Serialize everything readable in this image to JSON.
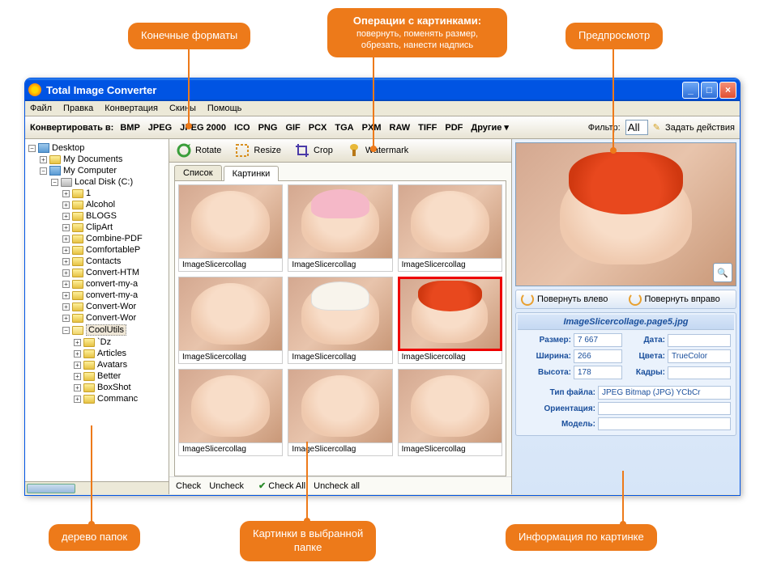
{
  "callouts": {
    "formats": "Конечные форматы",
    "ops": {
      "title": "Операции с картинками:",
      "sub": "повернуть, поменять размер, обрезать, нанести надпись"
    },
    "preview": "Предпросмотр",
    "tree": "дерево папок",
    "thumbs": {
      "l1": "Картинки в выбранной",
      "l2": "папке"
    },
    "info": "Информация по картинке"
  },
  "titlebar": {
    "title": "Total Image Converter"
  },
  "menu": {
    "file": "Файл",
    "edit": "Правка",
    "convert": "Конвертация",
    "skins": "Скины",
    "help": "Помощь"
  },
  "toolbar": {
    "label": "Конвертировать в:",
    "formats": [
      "BMP",
      "JPEG",
      "JPEG 2000",
      "ICO",
      "PNG",
      "GIF",
      "PCX",
      "TGA",
      "PXM",
      "RAW",
      "TIFF",
      "PDF"
    ],
    "more": "Другие",
    "filter": "Фильтр:",
    "filter_val": "All",
    "actions": "Задать действия"
  },
  "ops": {
    "rotate": "Rotate",
    "resize": "Resize",
    "crop": "Crop",
    "watermark": "Watermark"
  },
  "tabs": {
    "list": "Список",
    "pics": "Картинки"
  },
  "tree": {
    "desktop": "Desktop",
    "docs": "My Documents",
    "computer": "My Computer",
    "drive": "Local Disk (C:)",
    "folders": [
      "1",
      "Alcohol",
      "BLOGS",
      "ClipArt",
      "Combine-PDF",
      "ComfortableР",
      "Contacts",
      "Convert-HTM",
      "convert-my-a",
      "convert-my-a",
      "Convert-Wor",
      "Convert-Wor"
    ],
    "coolutils": "CoolUtils",
    "sub": [
      "`Dz",
      "Articles",
      "Avatars",
      "Better",
      "BoxShot",
      "Commanс"
    ]
  },
  "thumbs": {
    "label": "ImageSlicercollag"
  },
  "checkbar": {
    "check": "Check",
    "uncheck": "Uncheck",
    "checkall": "Check All",
    "uncheckall": "Uncheck all"
  },
  "preview": {
    "rotate_left": "Повернуть влево",
    "rotate_right": "Повернуть вправо",
    "filename": "ImageSlicercollage.page5.jpg",
    "labels": {
      "size": "Размер:",
      "width": "Ширина:",
      "height": "Высота:",
      "date": "Дата:",
      "colors": "Цвета:",
      "frames": "Кадры:",
      "filetype": "Тип файла:",
      "orientation": "Ориентация:",
      "model": "Модель:"
    },
    "values": {
      "size": "7 667",
      "width": "266",
      "height": "178",
      "date": "",
      "colors": "TrueColor",
      "frames": "",
      "filetype": "JPEG Bitmap (JPG) YCbCr",
      "orientation": "",
      "model": ""
    }
  }
}
